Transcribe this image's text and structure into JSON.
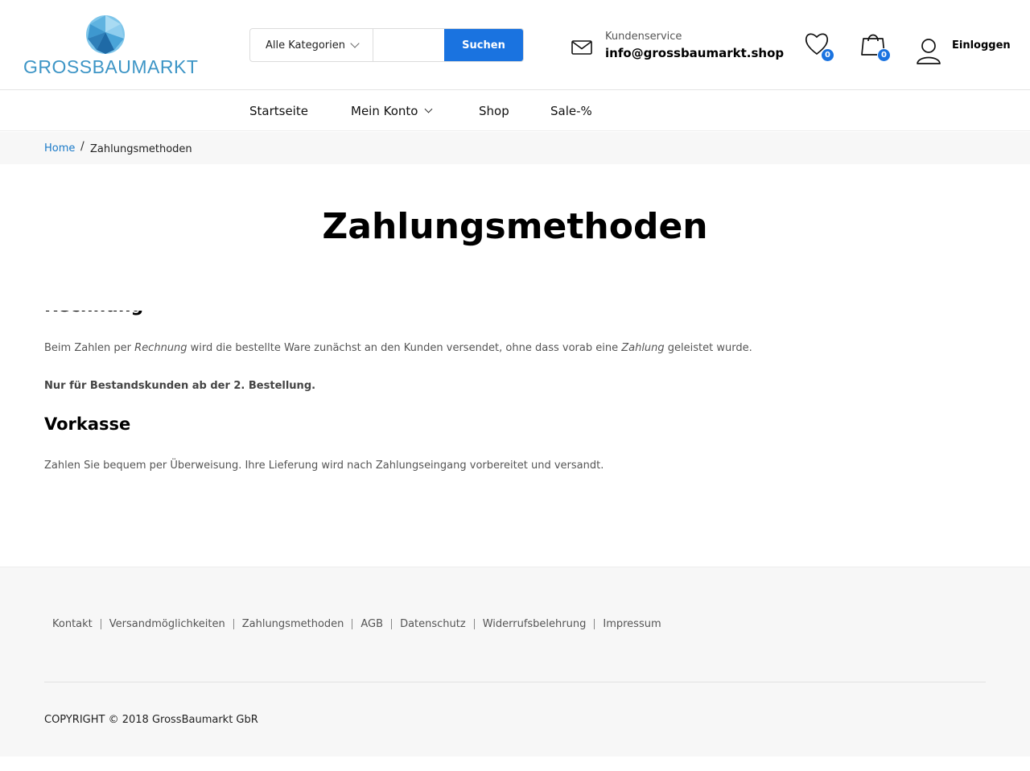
{
  "header": {
    "logo_text": "GROSSBAUMARKT",
    "search": {
      "category_label": "Alle Kategorien",
      "input_value": "",
      "button_label": "Suchen"
    },
    "support": {
      "label": "Kundenservice",
      "email": "info@grossbaumarkt.shop"
    },
    "wishlist_count": "0",
    "cart_count": "0",
    "login_label": "Einloggen"
  },
  "nav": {
    "items": [
      {
        "label": "Startseite"
      },
      {
        "label": "Mein Konto"
      },
      {
        "label": "Shop"
      },
      {
        "label": "Sale-%"
      }
    ]
  },
  "breadcrumb": {
    "home": "Home",
    "separator": "/",
    "current": "Zahlungsmethoden"
  },
  "main": {
    "title": "Zahlungsmethoden",
    "section1": {
      "para_prefix": "Beim Zahlen per ",
      "para_em1": "Rechnung",
      "para_mid": " wird die bestellte Ware zunächst an den Kunden versendet, ohne dass vorab eine ",
      "para_em2": "Zahlung",
      "para_suffix": " geleistet wurde.",
      "note": "Nur für Bestandskunden ab der 2. Bestellung."
    },
    "section2": {
      "heading": "Vorkasse",
      "para": "Zahlen Sie bequem per Überweisung. Ihre Lieferung wird nach Zahlungseingang vorbereitet und versandt."
    }
  },
  "footer": {
    "links": [
      {
        "label": "Kontakt"
      },
      {
        "label": "Versandmöglichkeiten"
      },
      {
        "label": "Zahlungsmethoden"
      },
      {
        "label": "AGB"
      },
      {
        "label": "Datenschutz"
      },
      {
        "label": "Widerrufsbelehrung"
      },
      {
        "label": "Impressum"
      }
    ],
    "copyright": "COPYRIGHT © 2018 GrossBaumarkt GbR"
  },
  "colors": {
    "accent": "#1a73e0",
    "logo": "#3d95c6",
    "link": "#1a7ac8"
  },
  "icons": [
    "logo-mark",
    "mail-icon",
    "heart-icon",
    "shopping-bag-icon",
    "user-icon",
    "chevron-down-icon"
  ]
}
